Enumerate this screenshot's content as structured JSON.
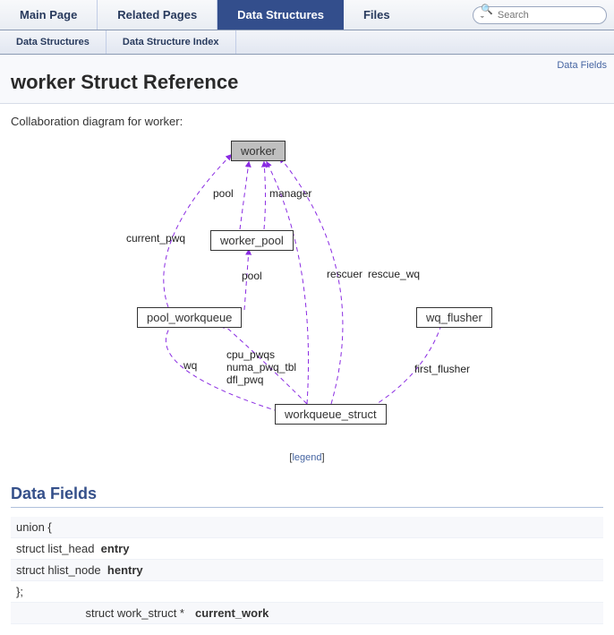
{
  "tabs": {
    "main": "Main Page",
    "related": "Related Pages",
    "data_structures": "Data Structures",
    "files": "Files"
  },
  "search": {
    "placeholder": "Search"
  },
  "subtabs": {
    "ds": "Data Structures",
    "dsi": "Data Structure Index"
  },
  "header": {
    "data_fields_link": "Data Fields",
    "title": "worker Struct Reference"
  },
  "intro": "Collaboration diagram for worker:",
  "diagram": {
    "nodes": {
      "worker": "worker",
      "worker_pool": "worker_pool",
      "pool_workqueue": "pool_workqueue",
      "wq_flusher": "wq_flusher",
      "workqueue_struct": "workqueue_struct"
    },
    "edge_labels": {
      "pool": "pool",
      "manager": "manager",
      "current_pwq": "current_pwq",
      "pool2": "pool",
      "rescuer": "rescuer",
      "rescue_wq": "rescue_wq",
      "wq": "wq",
      "cpu_pwqs": "cpu_pwqs\nnuma_pwq_tbl\ndfl_pwq",
      "first_flusher": "first_flusher"
    },
    "legend_open": "[",
    "legend_text": "legend",
    "legend_close": "]"
  },
  "section_data_fields": "Data Fields",
  "fields": {
    "union_open": "union {",
    "entry_type": "struct list_head",
    "entry_name": "entry",
    "hentry_type": "struct hlist_node",
    "hentry_name": "hentry",
    "union_close": "};",
    "current_work_type": "struct work_struct *",
    "current_work_name": "current_work"
  }
}
